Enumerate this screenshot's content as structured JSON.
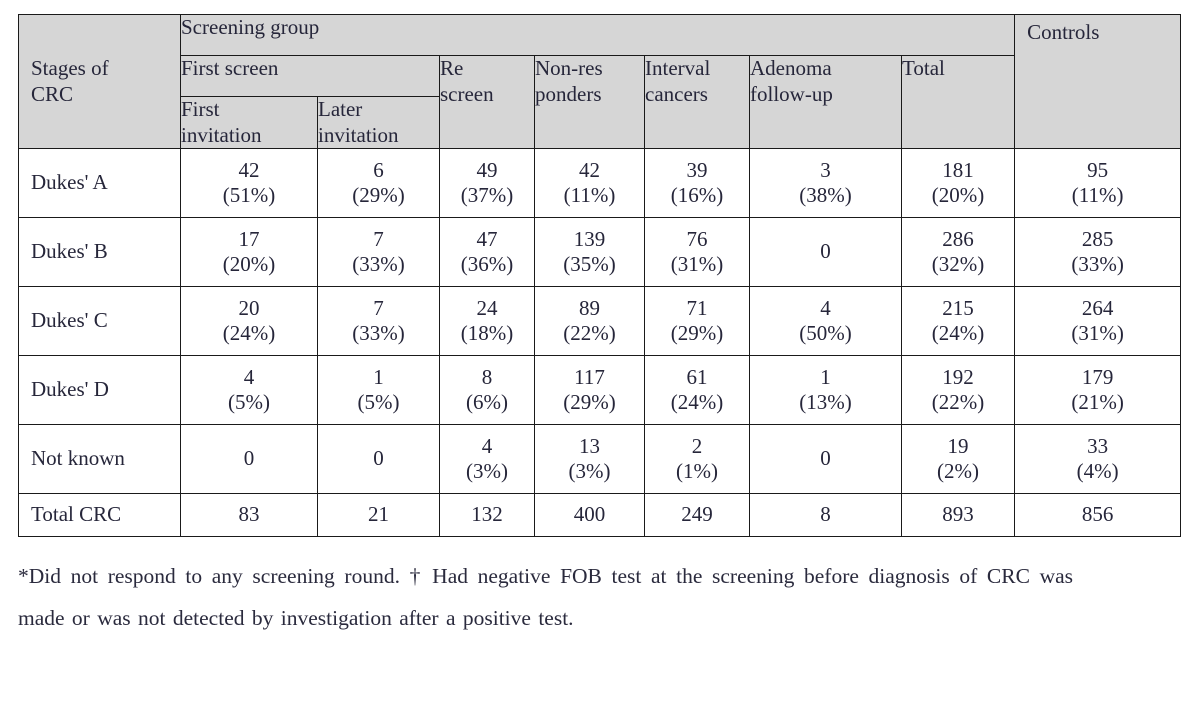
{
  "table": {
    "header": {
      "stub_label": [
        "Stages of",
        "CRC"
      ],
      "screening_group": "Screening group",
      "first_screen": "First screen",
      "columns": [
        {
          "lines": [
            "First",
            "invitation"
          ]
        },
        {
          "lines": [
            "Later",
            "invitation"
          ]
        },
        {
          "lines": [
            "Re",
            "screen"
          ]
        },
        {
          "lines": [
            "Non-res",
            "ponders"
          ]
        },
        {
          "lines": [
            "Interval",
            "cancers"
          ]
        },
        {
          "lines": [
            "Adenoma",
            "follow-up"
          ]
        },
        {
          "lines": [
            "Total"
          ]
        }
      ],
      "controls": "Controls"
    },
    "rows": [
      {
        "stage": "Dukes' A",
        "cells": [
          {
            "n": "42",
            "pct": "(51%)"
          },
          {
            "n": "6",
            "pct": "(29%)"
          },
          {
            "n": "49",
            "pct": "(37%)"
          },
          {
            "n": "42",
            "pct": "(11%)"
          },
          {
            "n": "39",
            "pct": "(16%)"
          },
          {
            "n": "3",
            "pct": "(38%)"
          },
          {
            "n": "181",
            "pct": "(20%)"
          },
          {
            "n": "95",
            "pct": "(11%)"
          }
        ]
      },
      {
        "stage": "Dukes' B",
        "cells": [
          {
            "n": "17",
            "pct": "(20%)"
          },
          {
            "n": "7",
            "pct": "(33%)"
          },
          {
            "n": "47",
            "pct": "(36%)"
          },
          {
            "n": "139",
            "pct": "(35%)"
          },
          {
            "n": "76",
            "pct": "(31%)"
          },
          {
            "n": "0",
            "pct": ""
          },
          {
            "n": "286",
            "pct": "(32%)"
          },
          {
            "n": "285",
            "pct": "(33%)"
          }
        ]
      },
      {
        "stage": "Dukes' C",
        "cells": [
          {
            "n": "20",
            "pct": "(24%)"
          },
          {
            "n": "7",
            "pct": "(33%)"
          },
          {
            "n": "24",
            "pct": "(18%)"
          },
          {
            "n": "89",
            "pct": "(22%)"
          },
          {
            "n": "71",
            "pct": "(29%)"
          },
          {
            "n": "4",
            "pct": "(50%)"
          },
          {
            "n": "215",
            "pct": "(24%)"
          },
          {
            "n": "264",
            "pct": "(31%)"
          }
        ]
      },
      {
        "stage": "Dukes' D",
        "cells": [
          {
            "n": "4",
            "pct": "(5%)"
          },
          {
            "n": "1",
            "pct": "(5%)"
          },
          {
            "n": "8",
            "pct": "(6%)"
          },
          {
            "n": "117",
            "pct": "(29%)"
          },
          {
            "n": "61",
            "pct": "(24%)"
          },
          {
            "n": "1",
            "pct": "(13%)"
          },
          {
            "n": "192",
            "pct": "(22%)"
          },
          {
            "n": "179",
            "pct": "(21%)"
          }
        ]
      },
      {
        "stage": "Not known",
        "cells": [
          {
            "n": "0",
            "pct": ""
          },
          {
            "n": "0",
            "pct": ""
          },
          {
            "n": "4",
            "pct": "(3%)"
          },
          {
            "n": "13",
            "pct": "(3%)"
          },
          {
            "n": "2",
            "pct": "(1%)"
          },
          {
            "n": "0",
            "pct": ""
          },
          {
            "n": "19",
            "pct": "(2%)"
          },
          {
            "n": "33",
            "pct": "(4%)"
          }
        ]
      },
      {
        "stage": "Total CRC",
        "is_total": true,
        "cells": [
          {
            "n": "83",
            "pct": ""
          },
          {
            "n": "21",
            "pct": ""
          },
          {
            "n": "132",
            "pct": ""
          },
          {
            "n": "400",
            "pct": ""
          },
          {
            "n": "249",
            "pct": ""
          },
          {
            "n": "8",
            "pct": ""
          },
          {
            "n": "893",
            "pct": ""
          },
          {
            "n": "856",
            "pct": ""
          }
        ]
      }
    ]
  },
  "footnote": {
    "text": "*Did not respond to any screening round. † Had negative FOB test at the screening before diagnosis of CRC was made or was not detected by investigation after a positive test."
  },
  "colors": {
    "header_background": "#d6d6d6",
    "border": "#1a1a1a",
    "text": "#26263a",
    "page_background": "#ffffff"
  }
}
